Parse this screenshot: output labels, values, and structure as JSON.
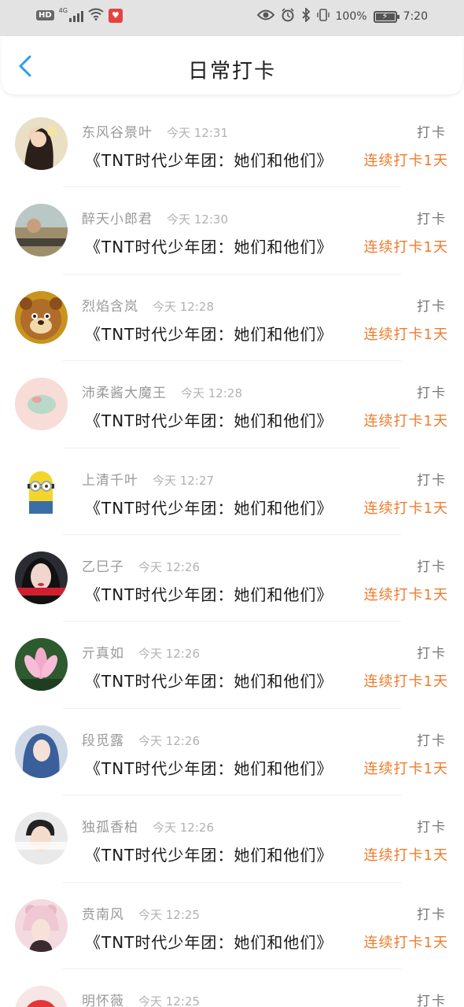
{
  "status_bar": {
    "hd": "HD",
    "network": "4G",
    "battery": "100%",
    "time": "7:20",
    "icons": [
      "signal-icon",
      "wifi-icon",
      "app-notification-icon",
      "eye-icon",
      "alarm-icon",
      "bluetooth-icon",
      "vibrate-icon",
      "battery-icon"
    ]
  },
  "header": {
    "title": "日常打卡",
    "back_icon": "chevron-left-icon",
    "accent": "#2a9df4"
  },
  "colors": {
    "streak": "#f07a2c",
    "name": "#999999",
    "time": "#b2b2b2"
  },
  "entries": [
    {
      "name": "东风谷景叶",
      "time": "今天 12:31",
      "action": "打卡",
      "content": "《TNT时代少年团：她们和他们》",
      "streak": "连续打卡1天",
      "avatar": "woman-with-flower-avatar"
    },
    {
      "name": "醉天小郎君",
      "time": "今天 12:30",
      "action": "打卡",
      "content": "《TNT时代少年团：她们和他们》",
      "streak": "连续打卡1天",
      "avatar": "landscape-text-avatar"
    },
    {
      "name": "烈焰含岚",
      "time": "今天 12:28",
      "action": "打卡",
      "content": "《TNT时代少年团：她们和他们》",
      "streak": "连续打卡1天",
      "avatar": "cartoon-bear-avatar"
    },
    {
      "name": "沛柔酱大魔王",
      "time": "今天 12:28",
      "action": "打卡",
      "content": "《TNT时代少年团：她们和他们》",
      "streak": "连续打卡1天",
      "avatar": "pastel-illustration-avatar"
    },
    {
      "name": "上清千叶",
      "time": "今天 12:27",
      "action": "打卡",
      "content": "《TNT时代少年团：她们和他们》",
      "streak": "连续打卡1天",
      "avatar": "minion-avatar"
    },
    {
      "name": "乙巳子",
      "time": "今天 12:26",
      "action": "打卡",
      "content": "《TNT时代少年团：她们和他们》",
      "streak": "连续打卡1天",
      "avatar": "woman-portrait-avatar"
    },
    {
      "name": "亓真如",
      "time": "今天 12:26",
      "action": "打卡",
      "content": "《TNT时代少年团：她们和他们》",
      "streak": "连续打卡1天",
      "avatar": "lotus-avatar"
    },
    {
      "name": "段觅露",
      "time": "今天 12:26",
      "action": "打卡",
      "content": "《TNT时代少年团：她们和他们》",
      "streak": "连续打卡1天",
      "avatar": "blue-hair-girl-avatar"
    },
    {
      "name": "独孤香柏",
      "time": "今天 12:26",
      "action": "打卡",
      "content": "《TNT时代少年团：她们和他们》",
      "streak": "连续打卡1天",
      "avatar": "boy-text-avatar"
    },
    {
      "name": "贲南风",
      "time": "今天 12:25",
      "action": "打卡",
      "content": "《TNT时代少年团：她们和他们》",
      "streak": "连续打卡1天",
      "avatar": "girl-bear-hat-avatar"
    },
    {
      "name": "明怀薇",
      "time": "今天 12:25",
      "action": "打卡",
      "content": "",
      "streak": "",
      "avatar": "red-cartoon-avatar"
    }
  ]
}
